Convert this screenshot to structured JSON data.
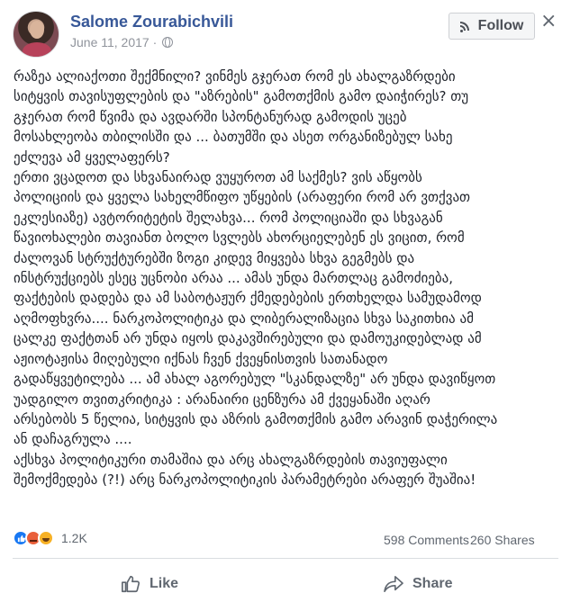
{
  "post": {
    "author": "Salome Zourabichvili",
    "date": "June 11, 2017 · ",
    "follow_label": "Follow",
    "text_lines": [
      "რაზეა ალიაქოთი შექმნილი? ვინმეს გჯერათ რომ ეს ახალგაზრდები",
      "სიტყვის თავისუფლების და \"აზრების\" გამოთქმის გამო დაიჭირეს? თუ",
      "გჯერათ რომ წვიმა და ავდარში სპონტანურად გამოდის უცებ",
      "მოსახლეობა თბილისში და ... ბათუმში და ასეთ ორგანიზებულ სახე",
      "ეძლევა ამ ყველაფერს?",
      "ერთი ვცადოთ და სხვანაირად ვუყუროთ ამ საქმეს? ვის აწყობს",
      "პოლიციის და ყველა სახელმწიფო უწყების (არაფერი რომ არ ვთქვათ",
      "ეკლესიაზე) ავტორიტეტის შელახვა... რომ პოლიციაში და სხვაგან",
      "წავიოხალები თავიანთ ბოლო სვლებს ახორციელებენ ეს ვიცით, რომ",
      "ძალოვან სტრუქტურებში ზოგი კიდევ მიყვება სხვა გეგმებს და",
      "ინსტრუქციებს ესეც უცნობი არაა ... ამას უნდა მართლაც გამოძიება,",
      "ფაქტების დადება და ამ საბოტაჟურ ქმედებების ერთხელდა სამუდამოდ",
      "აღმოფხვრა.... ნარკოპოლიტიკა და ლიბერალიზაცია სხვა საკითხია ამ",
      "ცალკე ფაქტთან არ უნდა იყოს დაკავშირებული და დამოუკიდებლად ამ",
      "აჟიოტაჟისა მიღებული იქნას ჩვენ ქვეყნისთვის სათანადო",
      "გადაწყვეტილება ... ამ ახალ აგორებულ \"სკანდალზე\" არ უნდა დავიწყოთ",
      "უადგილო თვითკრიტიკა : არანაირი ცენზურა ამ ქვეყანაში აღარ",
      "არსებობს 5 წელია, სიტყვის და აზრის გამოთქმის გამო არავინ დაჭერილა",
      "ან დაჩაგრულა ....",
      "აქსხვა პოლიტიკური თამაშია და არც ახალგაზრდების თავიუფალი",
      "შემოქმედება (?!) არც ნარკოპოლიტიკის პარამეტრები არაფერ შუაშია!"
    ]
  },
  "stats": {
    "reactions_count": "1.2K",
    "comments": "598 Comments",
    "shares": "260 Shares"
  },
  "actions": {
    "like_label": "Like",
    "share_label": "Share"
  },
  "colors": {
    "author_blue": "#385898",
    "meta_gray": "#90949c",
    "like_blue": "#1878f3",
    "angry_orange": "#e95f3a",
    "haha_yellow": "#f7b125"
  },
  "icons": [
    "avatar",
    "globe-icon",
    "rss-icon",
    "close-icon",
    "like-reaction-icon",
    "angry-reaction-icon",
    "haha-reaction-icon",
    "thumbs-up-icon",
    "share-arrow-icon"
  ]
}
